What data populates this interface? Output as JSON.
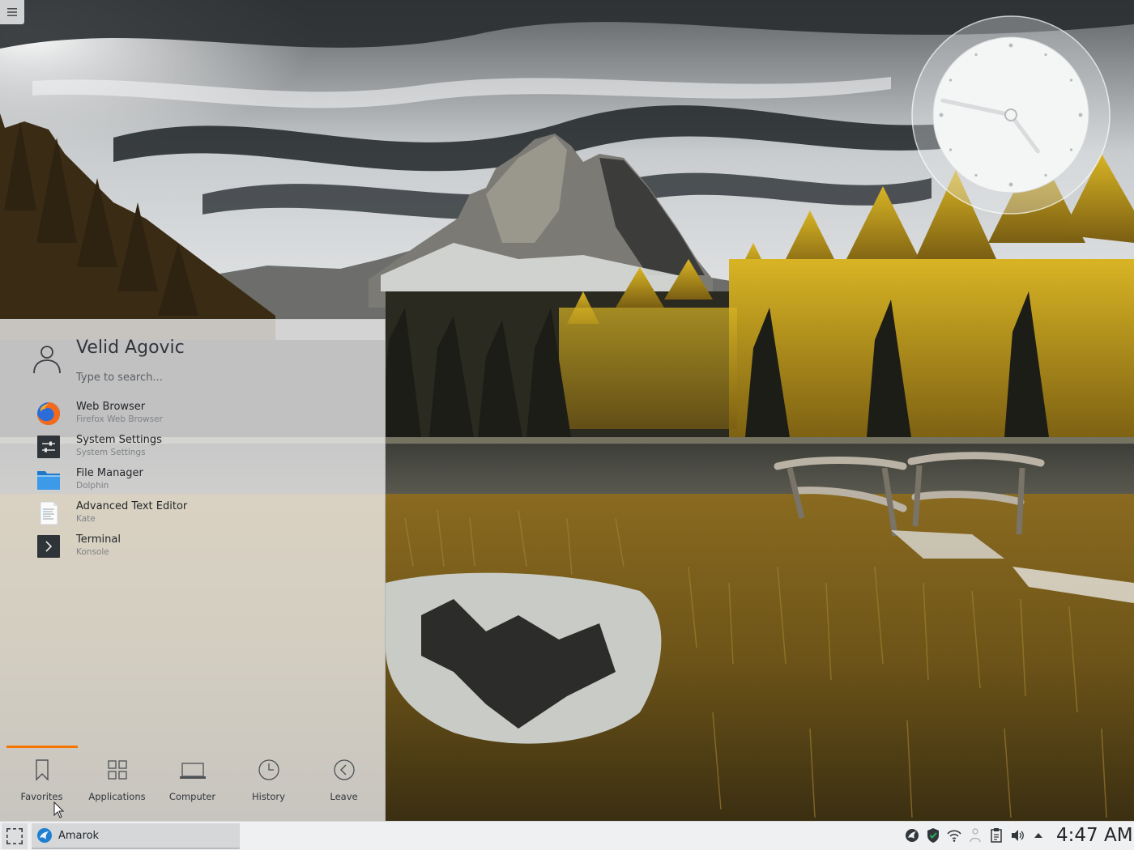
{
  "launcher": {
    "user_name": "Velid Agovic",
    "search_placeholder": "Type to search...",
    "favorites": [
      {
        "name": "Web Browser",
        "description": "Firefox Web Browser",
        "icon": "firefox-icon"
      },
      {
        "name": "System Settings",
        "description": "System Settings",
        "icon": "system-settings-icon"
      },
      {
        "name": "File Manager",
        "description": "Dolphin",
        "icon": "folder-icon"
      },
      {
        "name": "Advanced Text Editor",
        "description": "Kate",
        "icon": "text-editor-icon"
      },
      {
        "name": "Terminal",
        "description": "Konsole",
        "icon": "terminal-icon"
      }
    ],
    "tabs": [
      {
        "label": "Favorites",
        "icon": "bookmark-icon",
        "active": true
      },
      {
        "label": "Applications",
        "icon": "grid-icon",
        "active": false
      },
      {
        "label": "Computer",
        "icon": "laptop-icon",
        "active": false
      },
      {
        "label": "History",
        "icon": "clock-icon",
        "active": false
      },
      {
        "label": "Leave",
        "icon": "back-arrow-icon",
        "active": false
      }
    ],
    "active_tab_color": "#f67400"
  },
  "taskbar": {
    "tasks": [
      {
        "label": "Amarok",
        "icon": "amarok-icon"
      }
    ]
  },
  "tray": {
    "icons": [
      "amarok-tray-icon",
      "shield-check-icon",
      "wifi-icon",
      "network-icon",
      "clipboard-icon",
      "volume-icon",
      "arrow-up-icon"
    ],
    "time": "4:47 AM"
  },
  "clock_widget": {
    "hour": 4,
    "minute": 47
  }
}
